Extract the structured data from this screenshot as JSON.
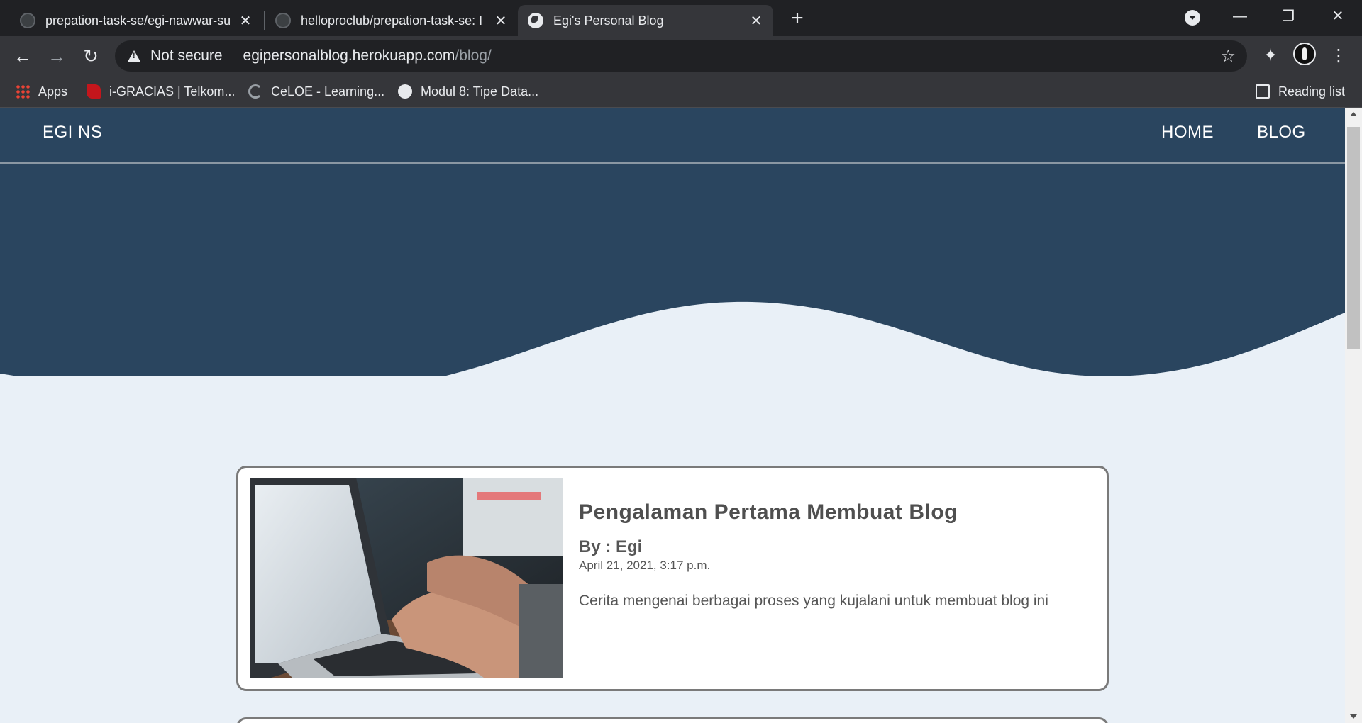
{
  "browser": {
    "tabs": [
      {
        "title": "prepation-task-se/egi-nawwar-su",
        "active": false
      },
      {
        "title": "helloproclub/prepation-task-se: I",
        "active": false
      },
      {
        "title": "Egi's Personal Blog",
        "active": true
      }
    ],
    "new_tab": "+",
    "window_controls": {
      "minimize": "—",
      "restore": "❐",
      "close": "✕"
    },
    "address": {
      "security_label": "Not secure",
      "host": "egipersonalblog.herokuapp.com",
      "path": "/blog/"
    },
    "bookmarks": [
      {
        "label": "Apps",
        "icon": "apps-grid-icon"
      },
      {
        "label": "i-GRACIAS | Telkom...",
        "icon": "telkom-icon"
      },
      {
        "label": "CeLOE - Learning...",
        "icon": "celoe-icon"
      },
      {
        "label": "Modul 8: Tipe Data...",
        "icon": "globe-icon"
      }
    ],
    "reading_list": "Reading list"
  },
  "site": {
    "brand": "EGI NS",
    "nav": [
      {
        "label": "HOME"
      },
      {
        "label": "BLOG"
      }
    ],
    "colors": {
      "primary": "#2a455f",
      "background": "#e9f0f7"
    }
  },
  "posts": [
    {
      "title": "Pengalaman Pertama Membuat Blog",
      "author": "By : Egi",
      "date": "April 21, 2021, 3:17 p.m.",
      "excerpt": "Cerita mengenai berbagai proses yang kujalani untuk membuat blog ini"
    }
  ]
}
